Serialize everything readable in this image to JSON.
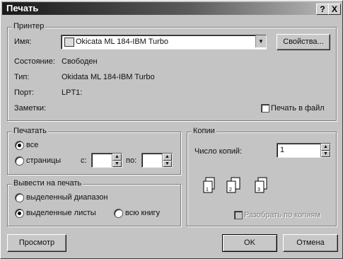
{
  "window": {
    "title": "Печать",
    "help_btn": "?",
    "close_btn": "X"
  },
  "printer": {
    "group_label": "Принтер",
    "name_label": "Имя:",
    "name_value": "Okicata ML 184-IBM Turbo",
    "properties_btn": "Свойства...",
    "status_label": "Состояние:",
    "status_value": "Свободен",
    "type_label": "Тип:",
    "type_value": "Okidata ML 184-IBM Turbo",
    "port_label": "Порт:",
    "port_value": "LPT1:",
    "notes_label": "Заметки:",
    "print_to_file": "Печать в файл"
  },
  "range": {
    "group_label": "Печатать",
    "all": "все",
    "pages": "страницы",
    "from_label": "с:",
    "to_label": "по:",
    "from_value": "",
    "to_value": ""
  },
  "output": {
    "group_label": "Вывести на печать",
    "selection": "выделенный диапазон",
    "sheets": "выделенные листы",
    "workbook": "всю книгу"
  },
  "copies": {
    "group_label": "Копии",
    "count_label": "Число копий:",
    "count_value": "1",
    "collate": "Разобрать по копиям"
  },
  "buttons": {
    "preview": "Просмотр",
    "ok": "OK",
    "cancel": "Отмена"
  }
}
